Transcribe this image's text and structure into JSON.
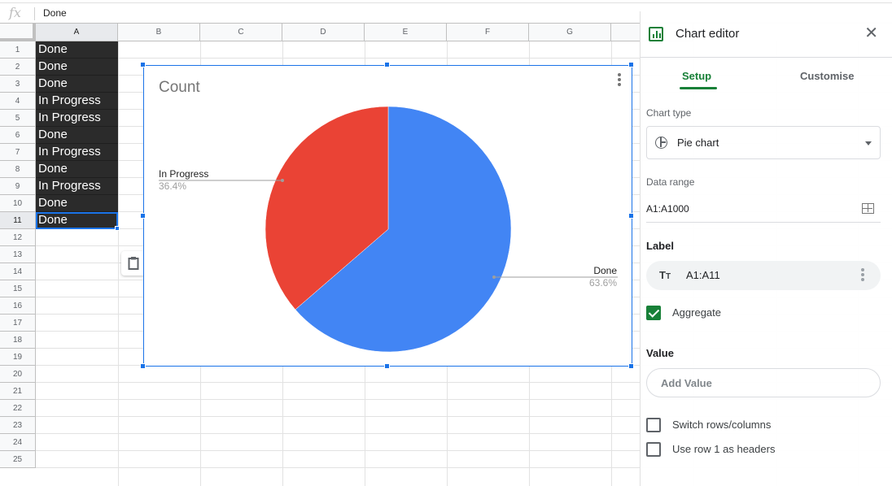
{
  "formula_bar": {
    "fx_label": "fx",
    "value": "Done"
  },
  "sheet": {
    "columns": [
      "A",
      "B",
      "C",
      "D",
      "E",
      "F",
      "G"
    ],
    "rows": [
      "1",
      "2",
      "3",
      "4",
      "5",
      "6",
      "7",
      "8",
      "9",
      "10",
      "11",
      "12",
      "13",
      "14",
      "15",
      "16",
      "17",
      "18",
      "19",
      "20",
      "21",
      "22",
      "23",
      "24",
      "25"
    ],
    "selected_column": "A",
    "active_row": "11",
    "column_a_values": [
      "Done",
      "Done",
      "Done",
      "In Progress",
      "In Progress",
      "Done",
      "In Progress",
      "Done",
      "In Progress",
      "Done",
      "Done"
    ]
  },
  "paste_button": {
    "icon": "clipboard-icon"
  },
  "chart": {
    "colors": {
      "done": "#4285f4",
      "in_progress": "#ea4335"
    },
    "menu_icon": "more-vert-icon"
  },
  "chart_data": {
    "type": "pie",
    "title": "Count",
    "categories": [
      "Done",
      "In Progress"
    ],
    "values": [
      7,
      4
    ],
    "percentages": [
      "63.6%",
      "36.4%"
    ],
    "colors": [
      "#4285f4",
      "#ea4335"
    ],
    "start_angle_deg": 0,
    "labels_placement": "outside-with-leader-lines"
  },
  "panel": {
    "title": "Chart editor",
    "icon": "bar-chart-icon",
    "close_icon": "close-icon",
    "tabs": [
      {
        "label": "Setup",
        "active": true
      },
      {
        "label": "Customise",
        "active": false
      }
    ],
    "chart_type_label": "Chart type",
    "chart_type_value": "Pie chart",
    "data_range_label": "Data range",
    "data_range_value": "A1:A1000",
    "label_heading": "Label",
    "label_chip_value": "A1:A11",
    "aggregate_label": "Aggregate",
    "aggregate_checked": true,
    "value_heading": "Value",
    "add_value_label": "Add Value",
    "switch_rows_label": "Switch rows/columns",
    "switch_rows_checked": false,
    "use_row1_label": "Use row 1 as headers",
    "use_row1_checked": false
  }
}
